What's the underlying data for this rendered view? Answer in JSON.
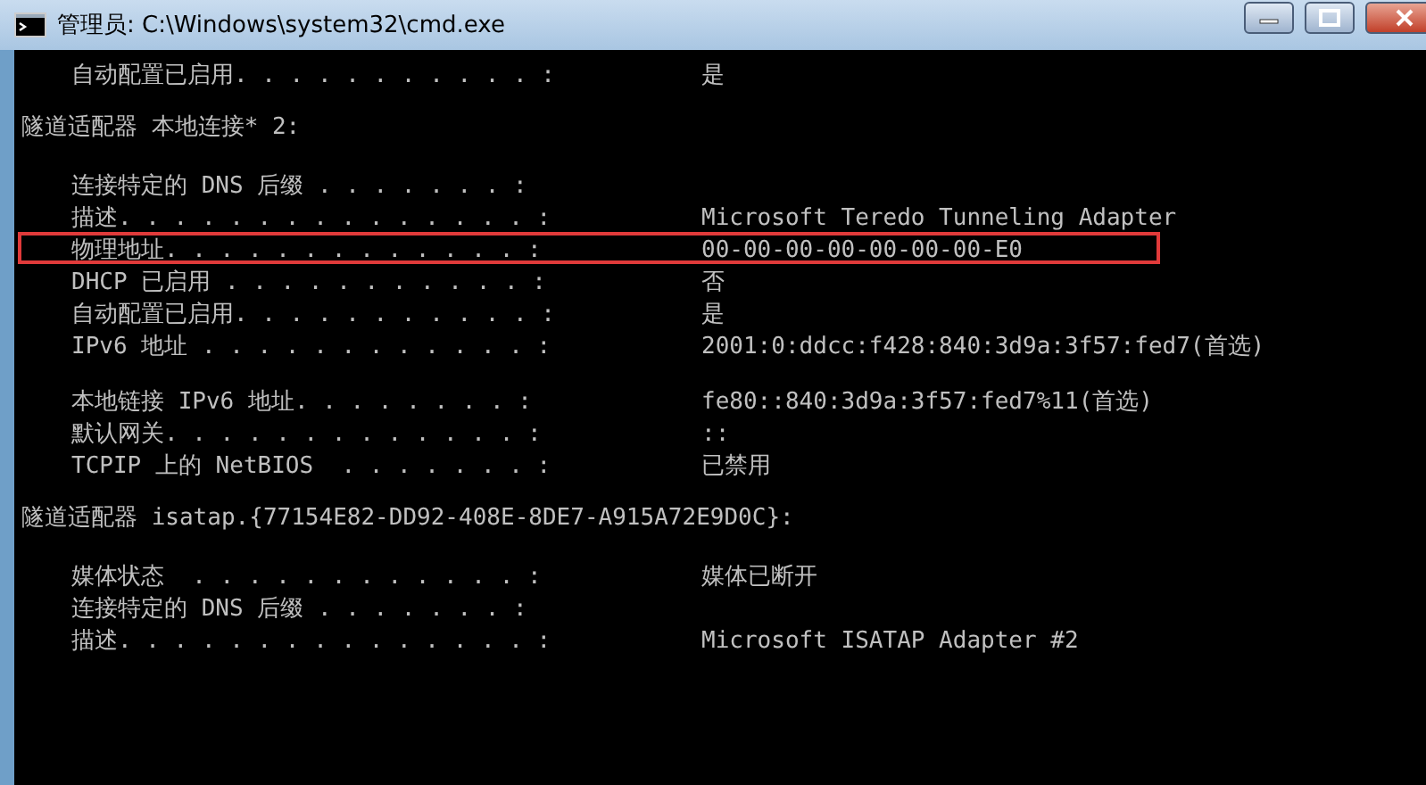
{
  "window": {
    "title": "管理员: C:\\Windows\\system32\\cmd.exe"
  },
  "console_lines": [
    {
      "kind": "entry",
      "label": "自动配置已启用. . . . . . . . . . . :",
      "value": "是",
      "highlighted": false
    },
    {
      "kind": "blank"
    },
    {
      "kind": "heading",
      "text": "隧道适配器 本地连接* 2:"
    },
    {
      "kind": "blank"
    },
    {
      "kind": "entry",
      "label": "连接特定的 DNS 后缀 . . . . . . . :",
      "highlighted": false
    },
    {
      "kind": "entry",
      "label": "描述. . . . . . . . . . . . . . . :",
      "value": "Microsoft Teredo Tunneling Adapter",
      "highlighted": false
    },
    {
      "kind": "entry",
      "label": "物理地址. . . . . . . . . . . . . :",
      "value": "00-00-00-00-00-00-00-E0",
      "highlighted": true
    },
    {
      "kind": "entry",
      "label": "DHCP 已启用 . . . . . . . . . . . :",
      "value": "否",
      "highlighted": false
    },
    {
      "kind": "entry",
      "label": "自动配置已启用. . . . . . . . . . . :",
      "value": "是",
      "highlighted": false
    },
    {
      "kind": "entry",
      "label": "IPv6 地址 . . . . . . . . . . . . :",
      "value": "2001:0:ddcc:f428:840:3d9a:3f57:fed7(首选)",
      "highlighted": false
    },
    {
      "kind": "blank"
    },
    {
      "kind": "entry",
      "label": "本地链接 IPv6 地址. . . . . . . . :",
      "value": "fe80::840:3d9a:3f57:fed7%11(首选)",
      "highlighted": false
    },
    {
      "kind": "entry",
      "label": "默认网关. . . . . . . . . . . . . :",
      "value": "::",
      "highlighted": false
    },
    {
      "kind": "entry",
      "label": "TCPIP 上的 NetBIOS  . . . . . . . :",
      "value": "已禁用",
      "highlighted": false
    },
    {
      "kind": "blank"
    },
    {
      "kind": "heading",
      "text": "隧道适配器 isatap.{77154E82-DD92-408E-8DE7-A915A72E9D0C}:"
    },
    {
      "kind": "blank"
    },
    {
      "kind": "entry",
      "label": "媒体状态  . . . . . . . . . . . . :",
      "value": "媒体已断开",
      "highlighted": false
    },
    {
      "kind": "entry",
      "label": "连接特定的 DNS 后缀 . . . . . . . :",
      "highlighted": false
    },
    {
      "kind": "entry",
      "label": "描述. . . . . . . . . . . . . . . :",
      "value": "Microsoft ISATAP Adapter #2",
      "highlighted": false
    }
  ]
}
